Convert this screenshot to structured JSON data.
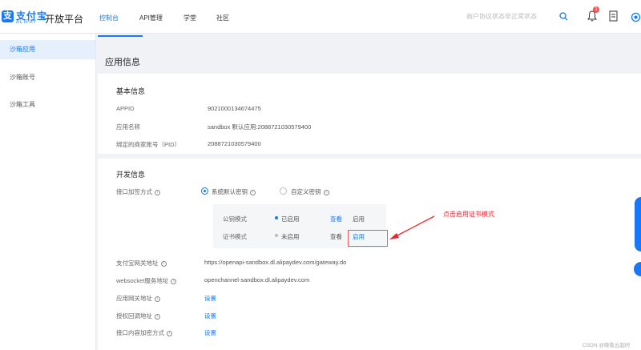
{
  "header": {
    "logo_cn": "支付宝",
    "logo_en": "ALIPAY",
    "platform": "开放平台",
    "tabs": [
      "控制台",
      "API管理",
      "学堂",
      "社区"
    ],
    "search_placeholder": "商户协议状态非正常状态",
    "notification_count": "1"
  },
  "sidebar": {
    "items": [
      "沙箱应用",
      "沙箱账号",
      "沙箱工具"
    ]
  },
  "main": {
    "title": "应用信息",
    "basic": {
      "title": "基本信息",
      "rows": [
        {
          "label": "APPID",
          "value": "9021000134674475"
        },
        {
          "label": "应用名称",
          "value": "sandbox 默认应用:2088721030579400"
        },
        {
          "label": "绑定的商家账号（PID）",
          "value": "2088721030579400"
        }
      ]
    },
    "dev": {
      "title": "开发信息",
      "sign_label": "接口加签方式",
      "option_default": "系统默认密钥",
      "option_custom": "自定义密钥",
      "modes": [
        {
          "name": "公钥模式",
          "status": "已启用",
          "view": "查看",
          "action": "启用"
        },
        {
          "name": "证书模式",
          "status": "未启用",
          "view": "查看",
          "action": "启用"
        }
      ],
      "rows": [
        {
          "label": "支付宝网关地址",
          "value": "https://openapi-sandbox.dl.alipaydev.com/gateway.do"
        },
        {
          "label": "websocket服务地址",
          "value": "openchannel-sandbox.dl.alipaydev.com"
        },
        {
          "label": "应用网关地址",
          "value": "设置"
        },
        {
          "label": "授权回调地址",
          "value": "设置"
        },
        {
          "label": "接口内容加密方式",
          "value": "设置"
        }
      ]
    }
  },
  "annotation": "点击启用证书模式",
  "watermark": "CSDN @晓看云起时",
  "colors": {
    "accent": "#1677ff",
    "annotation": "#f5222d",
    "enabled_dot": "#1677ff",
    "disabled_dot": "#bbbbbb"
  }
}
